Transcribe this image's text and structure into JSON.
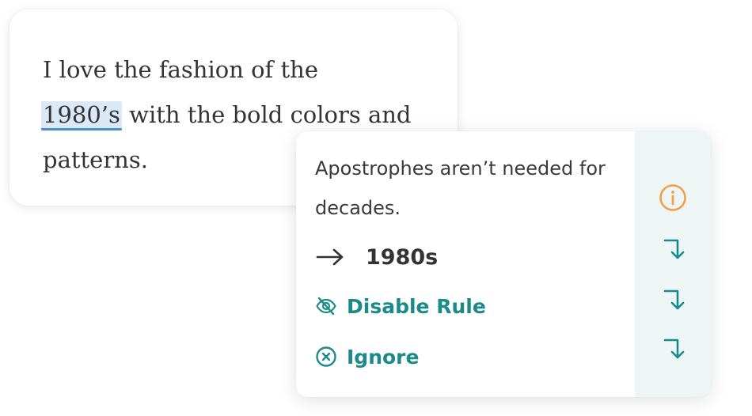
{
  "editor": {
    "text_before": "I love the fashion of the",
    "highlighted_word": "1980’s",
    "text_after": " with the bold colors and patterns."
  },
  "popover": {
    "message": "Apostrophes aren’t needed for decades.",
    "replacement": "1980s",
    "disable_rule_label": "Disable Rule",
    "ignore_label": "Ignore",
    "icons": {
      "replacement": "arrow-right-icon",
      "disable_rule": "eye-slash-icon",
      "ignore": "x-circle-icon",
      "side_top": "info-icon",
      "side_nav": "turn-down-arrow-icon"
    }
  },
  "colors": {
    "accent_teal": "#1a8a8a",
    "info_orange": "#f0a04b",
    "highlight_fill": "#dbe9f7",
    "highlight_underline": "#4a8fd6",
    "side_panel": "#eef6f5"
  }
}
